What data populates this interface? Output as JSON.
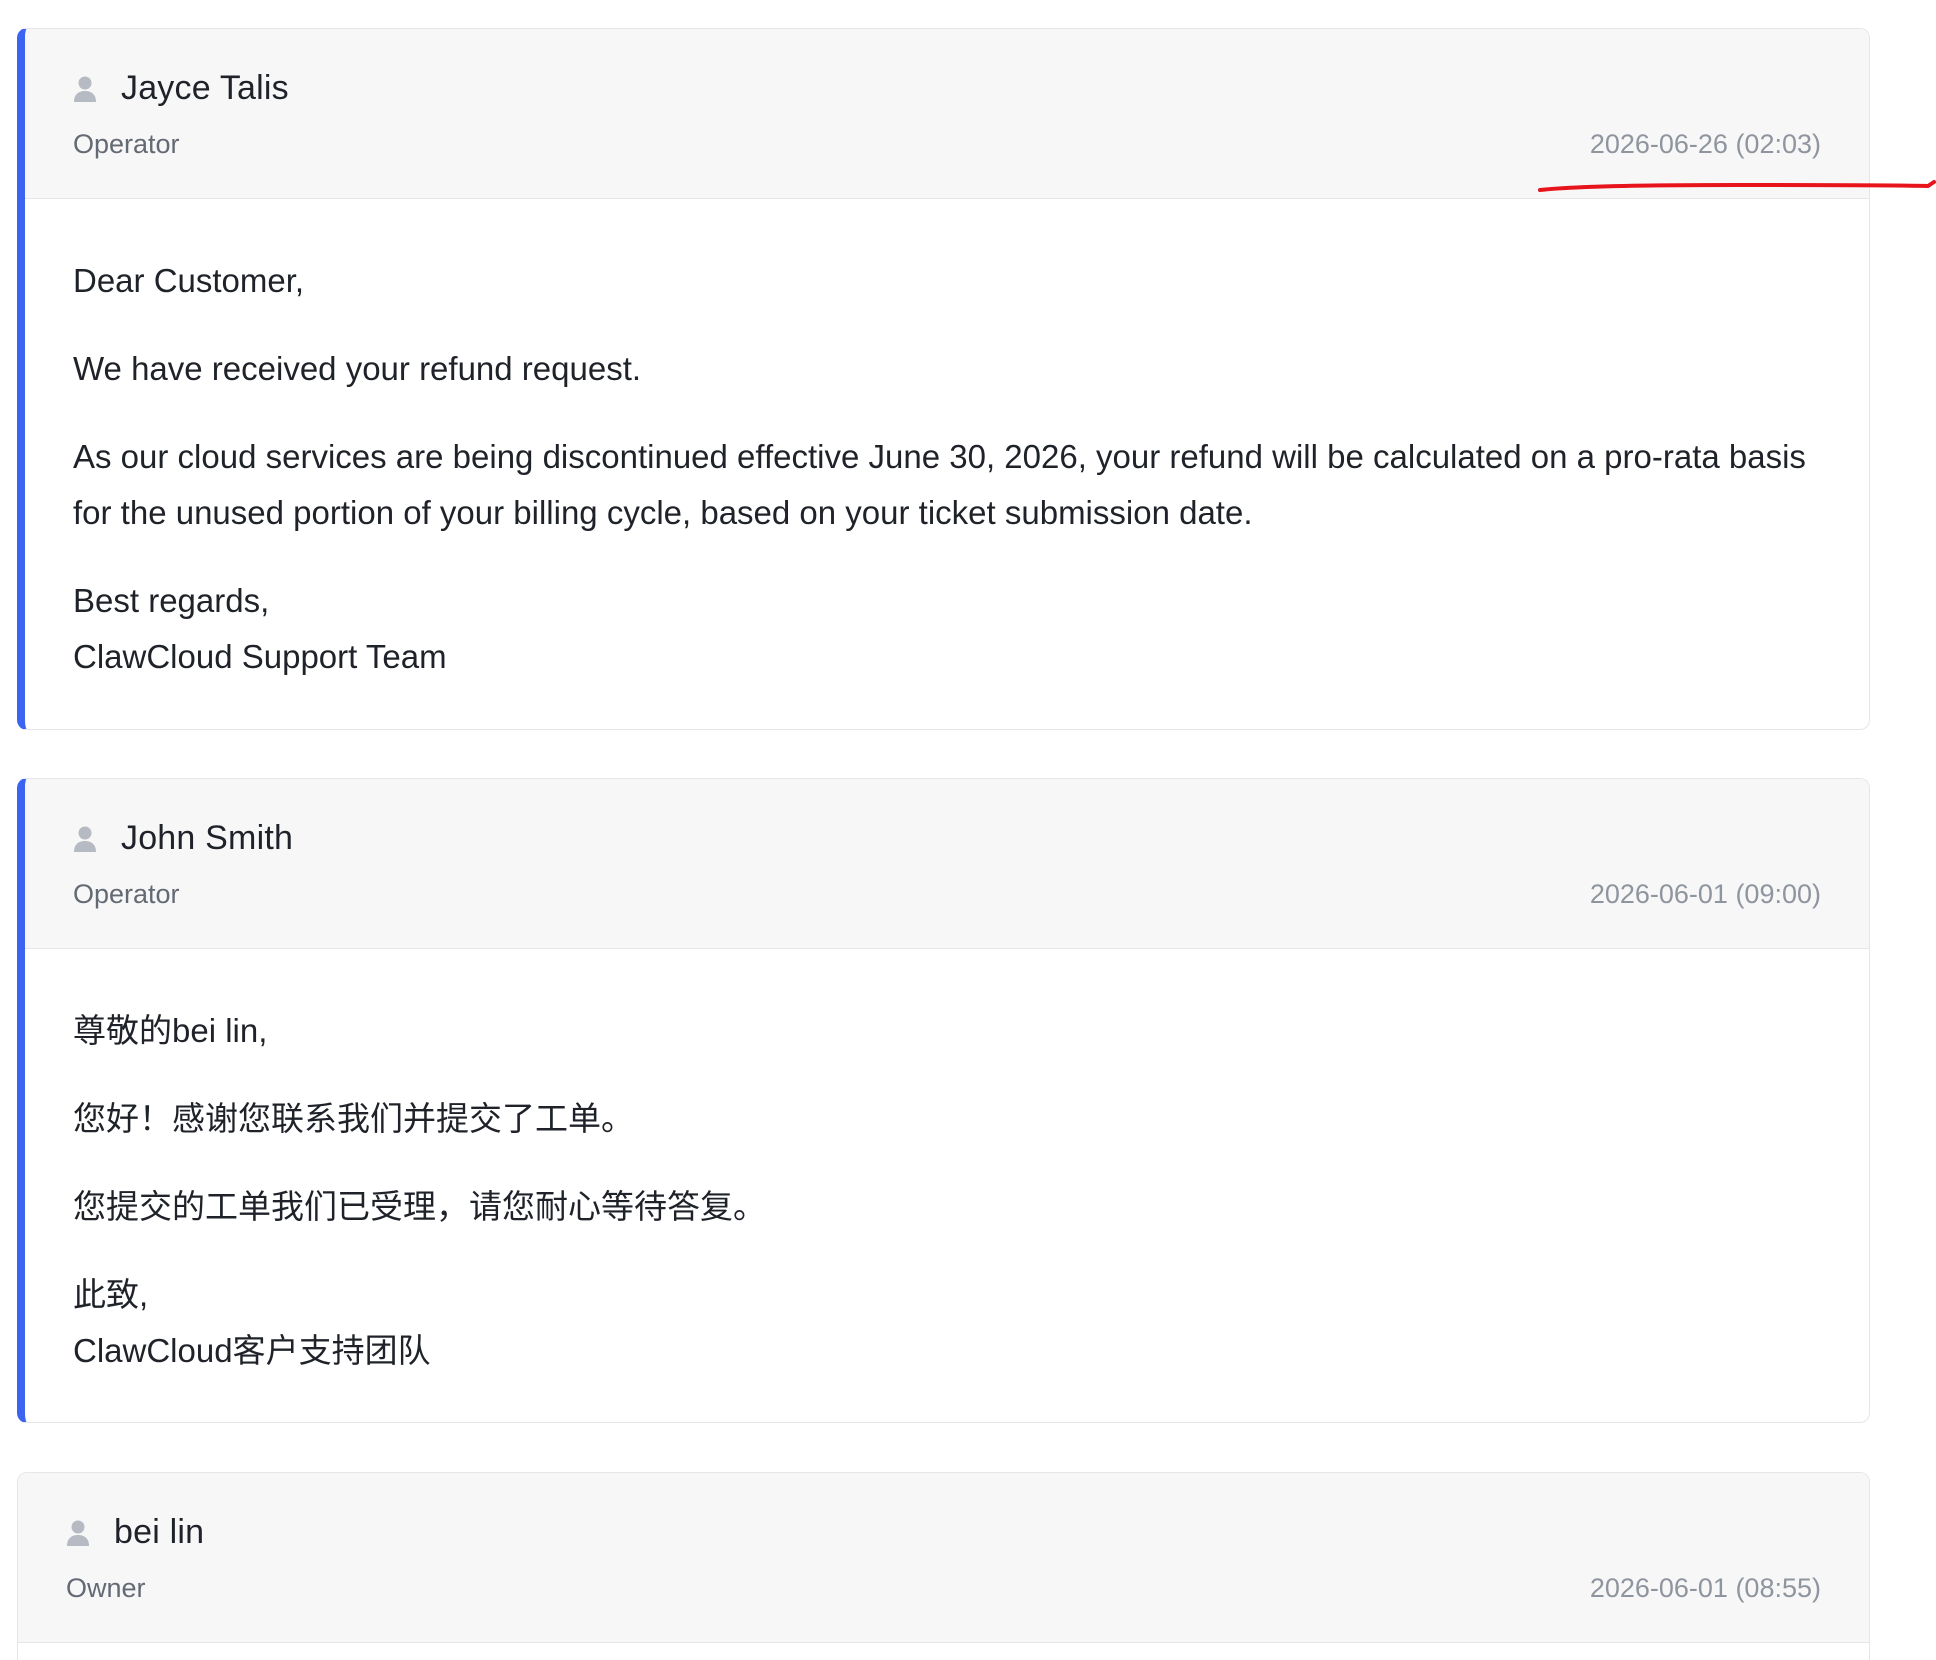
{
  "messages": [
    {
      "author": "Jayce Talis",
      "role": "Operator",
      "timestamp": "2026-06-26 (02:03)",
      "accent": "#3b64f0",
      "body": {
        "greeting": "Dear Customer,",
        "p1": "We have received your refund request.",
        "p2": "As our cloud services are being discontinued effective June 30, 2026, your refund will be calculated on a pro-rata basis for the unused portion of your billing cycle, based on your ticket submission date.",
        "closing": "Best regards,",
        "signature": "ClawCloud Support Team"
      }
    },
    {
      "author": "John Smith",
      "role": "Operator",
      "timestamp": "2026-06-01 (09:00)",
      "accent": "#3b64f0",
      "body": {
        "greeting": "尊敬的bei lin,",
        "p1": "您好！感谢您联系我们并提交了工单。",
        "p2": "您提交的工单我们已受理，请您耐心等待答复。",
        "closing": "此致,",
        "signature": "ClawCloud客户支持团队"
      }
    },
    {
      "author": "bei lin",
      "role": "Owner",
      "timestamp": "2026-06-01 (08:55)"
    }
  ],
  "annotation_color": "#e8141c",
  "icons": {
    "author": "person-icon"
  }
}
